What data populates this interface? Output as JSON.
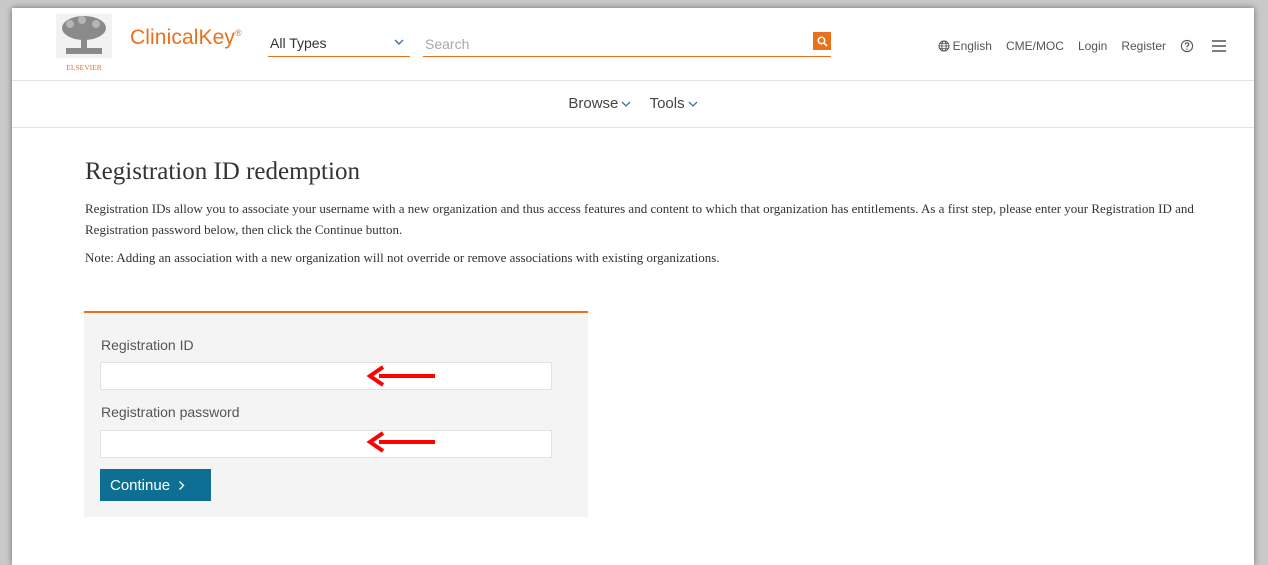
{
  "header": {
    "brand": "ClinicalKey",
    "brand_mark": "®",
    "publisher": "ELSEVIER",
    "type_select": {
      "value": "All Types"
    },
    "search": {
      "placeholder": "Search",
      "value": ""
    },
    "utility": {
      "language": "English",
      "cme": "CME/MOC",
      "login": "Login",
      "register": "Register"
    }
  },
  "nav": {
    "items": [
      {
        "label": "Browse"
      },
      {
        "label": "Tools"
      }
    ]
  },
  "main": {
    "title": "Registration ID redemption",
    "description": "Registration IDs allow you to associate your username with a new organization and thus access features and content to which that organization has entitlements. As a first step, please enter your Registration ID and Registration password below, then click the Continue button.",
    "note": "Note: Adding an association with a new organization will not override or remove associations with existing organizations."
  },
  "form": {
    "registration_id_label": "Registration ID",
    "registration_id_value": "",
    "registration_password_label": "Registration password",
    "registration_password_value": "",
    "continue_label": "Continue"
  },
  "colors": {
    "accent": "#e9711c",
    "button": "#0c6f93",
    "annotation_arrow": "#ff0000"
  },
  "icons": [
    "elsevier-logo",
    "chevron-down-icon",
    "search-icon",
    "globe-icon",
    "help-icon",
    "menu-icon",
    "chevron-right-icon",
    "red-arrow-annotation"
  ]
}
